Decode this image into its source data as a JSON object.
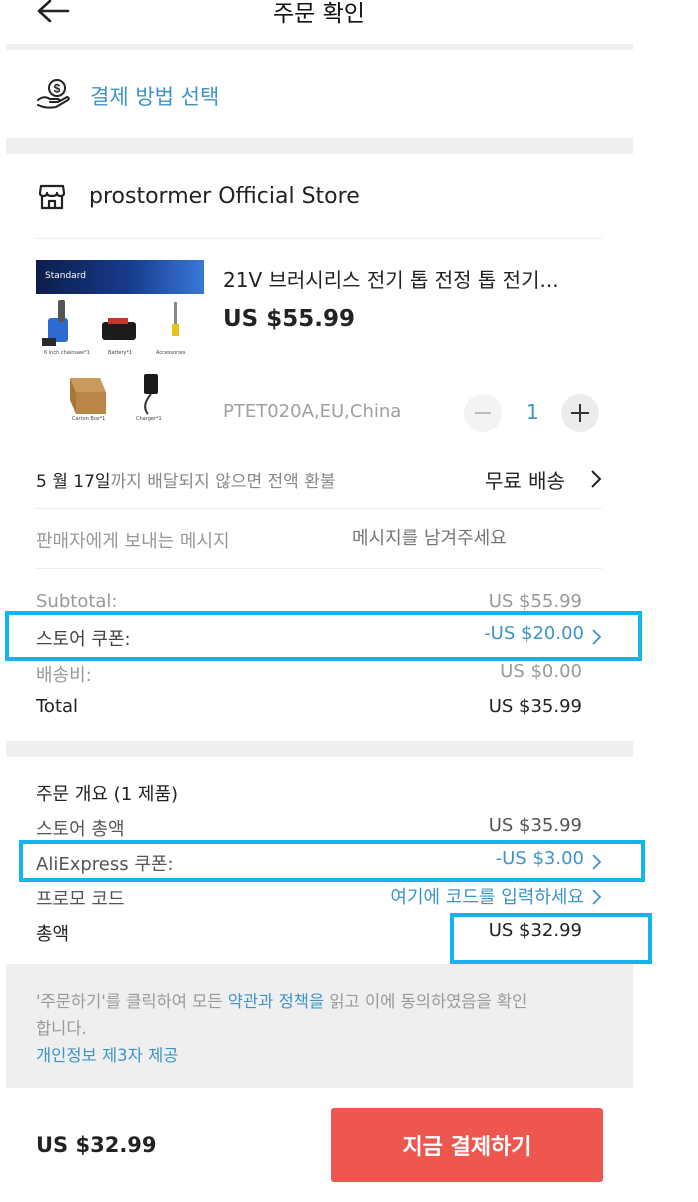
{
  "header": {
    "title": "주문 확인"
  },
  "payment": {
    "label": "결제 방법 선택"
  },
  "store": {
    "name": "prostormer Official Store"
  },
  "product": {
    "title": "21V 브러시리스 전기 톱 전정 톱 전기...",
    "price": "US $55.99",
    "variant": "PTET020A,EU,China",
    "quantity": "1",
    "image": {
      "banner": "Standard",
      "captions": [
        "6 inch chainsaw*1",
        "Battery*1",
        "Accessories",
        "Carton Box*1",
        "Charger*1"
      ]
    }
  },
  "delivery": {
    "date_bold": "5 월 17일",
    "date_rest": "까지 배달되지 않으면 전액 환불",
    "shipping": "무료 배송"
  },
  "message": {
    "label": "판매자에게 보내는 메시지",
    "placeholder": "메시지를 남겨주세요"
  },
  "summary": {
    "subtotal_label": "Subtotal:",
    "subtotal_value": "US $55.99",
    "coupon_label": "스토어 쿠폰:",
    "coupon_value": "-US $20.00",
    "shipping_label": "배송비:",
    "shipping_value": "US $0.00",
    "total_label": "Total",
    "total_value": "US $35.99"
  },
  "overview": {
    "title": "주문 개요 (1 제품)",
    "store_total_label": "스토어 총액",
    "store_total_value": "US $35.99",
    "ali_coupon_label": "AliExpress 쿠폰:",
    "ali_coupon_value": "-US $3.00",
    "promo_label": "프로모 코드",
    "promo_value": "여기에 코드를 입력하세요",
    "grand_label": "총액",
    "grand_value": "US $32.99"
  },
  "terms": {
    "prefix": "'주문하기'를 클릭하여 모든 ",
    "link": "약관과 정책을",
    "suffix": " 읽고 이에 동의하였음을 확인",
    "line2": "합니다.",
    "privacy": "개인정보 제3자 제공"
  },
  "footer": {
    "total": "US $32.99",
    "pay_button": "지금 결제하기"
  },
  "colors": {
    "accent_blue": "#3d94c7",
    "pay_button": "#ee5650",
    "highlight": "#14b4ee",
    "section_gray": "#efefef"
  }
}
